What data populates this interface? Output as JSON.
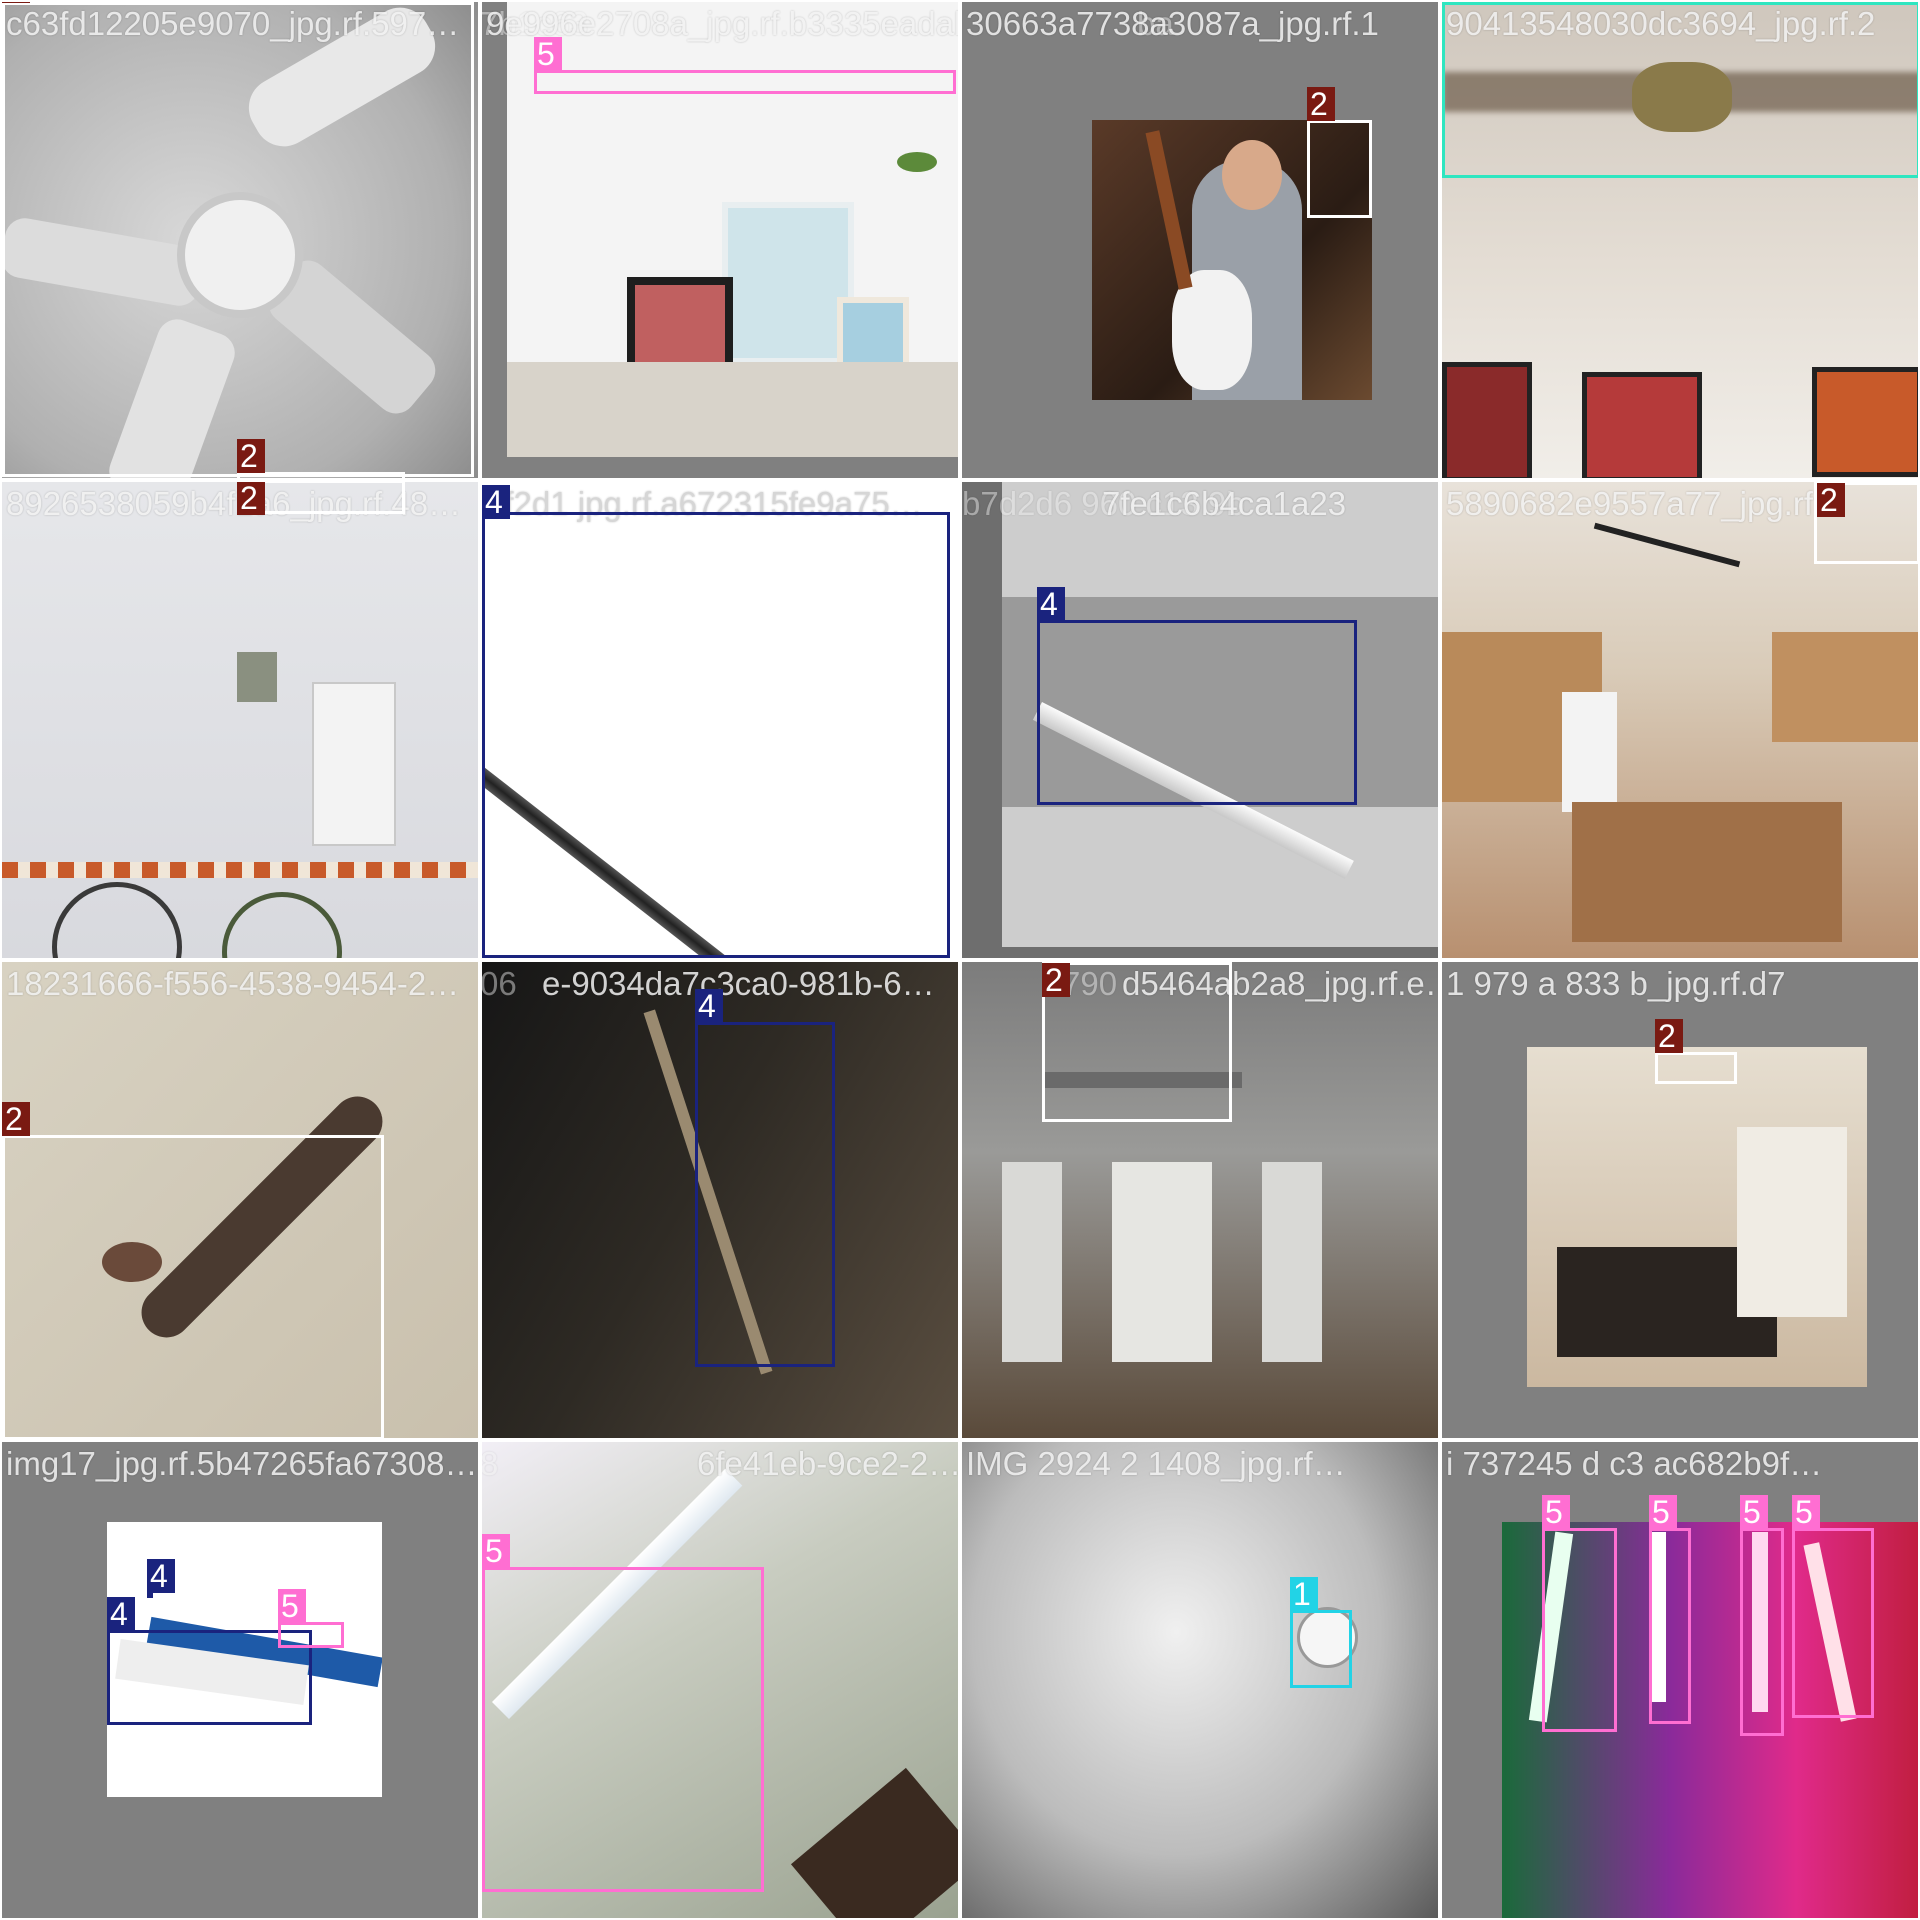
{
  "colors": {
    "cls1": "#22d3e6",
    "cls2": "#ffffff",
    "cls2_label_bg": "#7a1a12",
    "cls3": "#2ee6c0",
    "cls4": "#1a237e",
    "cls5": "#ff6ed2"
  },
  "tiles": [
    {
      "caption": "c63fd12205e9070_jpg.rf.597…",
      "ghost": "",
      "boxes": [
        {
          "cls": "2"
        },
        {
          "cls": "2"
        }
      ]
    },
    {
      "caption": "9e996e2708a_jpg.rf.b3335eadab",
      "ghost": "7b1c63",
      "boxes": [
        {
          "cls": "5"
        }
      ]
    },
    {
      "caption": "30663a7738a3087a_jpg.rf.1",
      "ghost": "ba",
      "boxes": [
        {
          "cls": "2"
        }
      ]
    },
    {
      "caption": "90413548030dc3694_jpg.rf.2",
      "ghost": "",
      "boxes": [
        {
          "cls": "3"
        }
      ]
    },
    {
      "caption": "8926538059b4f1a6_jpg.rf.48…",
      "ghost": "",
      "boxes": [
        {
          "cls": "2"
        }
      ]
    },
    {
      "caption": "7f2d1 jpg.rf.a672315fe9a75…",
      "ghost": "",
      "boxes": [
        {
          "cls": "4"
        }
      ]
    },
    {
      "caption": "7fe1c6b4ca1a23",
      "ghost": "b7d2d6 960 c13 9b",
      "boxes": [
        {
          "cls": "4"
        }
      ]
    },
    {
      "caption": "5890682e9557a77_jpg.rf.e",
      "ghost": "",
      "boxes": [
        {
          "cls": "2"
        }
      ]
    },
    {
      "caption": "18231666-f556-4538-9454-2…",
      "ghost": "",
      "boxes": [
        {
          "cls": "2"
        }
      ]
    },
    {
      "caption": "e-9034da7c3ca0-981b-6…",
      "ghost": "06",
      "boxes": [
        {
          "cls": "4"
        }
      ]
    },
    {
      "caption": "d5464ab2a8_jpg.rf.e…",
      "ghost": "790",
      "boxes": [
        {
          "cls": "2"
        }
      ]
    },
    {
      "caption": "1 979 a 833 b_jpg.rf.d7",
      "ghost": "",
      "boxes": [
        {
          "cls": "2"
        }
      ]
    },
    {
      "caption": "img17_jpg.rf.5b47265fa67308…",
      "ghost": "",
      "boxes": [
        {
          "cls": "4"
        },
        {
          "cls": "4"
        },
        {
          "cls": "5"
        }
      ]
    },
    {
      "caption": "6fe41eb-9ce2-2…",
      "ghost": "8",
      "boxes": [
        {
          "cls": "5"
        }
      ]
    },
    {
      "caption": "IMG 2924 2 1408_jpg.rf…",
      "ghost": "",
      "boxes": [
        {
          "cls": "1"
        }
      ]
    },
    {
      "caption": "i 737245 d c3 ac682b9f…",
      "ghost": "",
      "boxes": [
        {
          "cls": "5"
        },
        {
          "cls": "5"
        },
        {
          "cls": "5"
        },
        {
          "cls": "5"
        }
      ]
    }
  ]
}
